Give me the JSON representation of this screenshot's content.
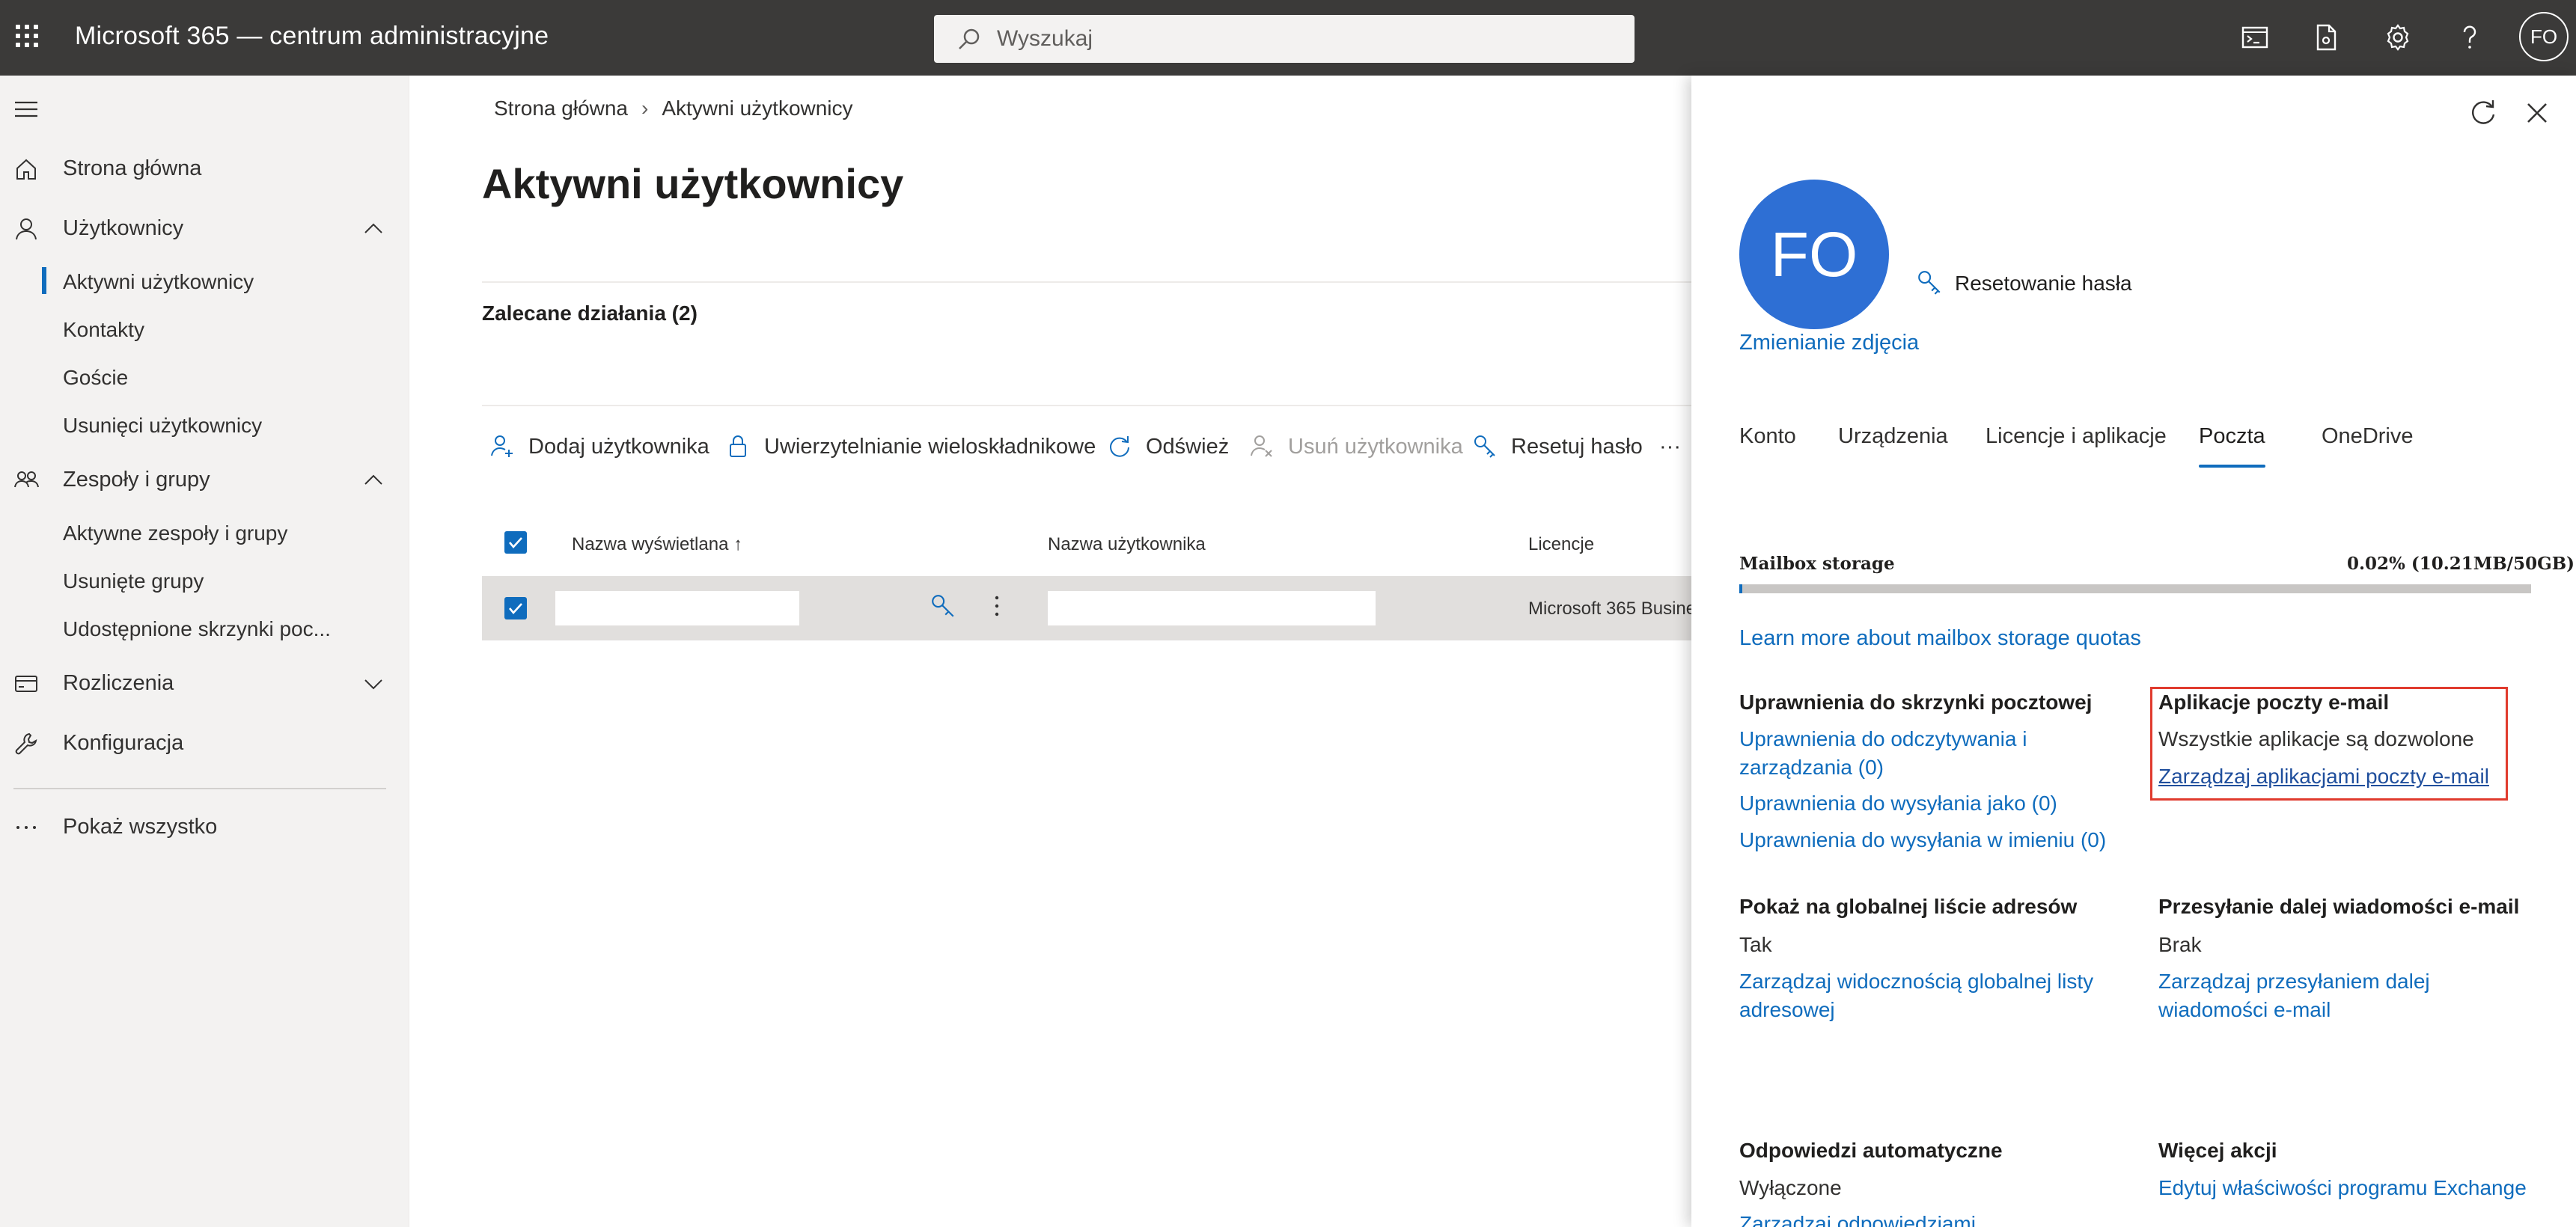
{
  "header": {
    "app_title": "Microsoft 365 — centrum administracyjne",
    "search_placeholder": "Wyszukaj",
    "user_initials": "FO"
  },
  "nav": {
    "home": "Strona główna",
    "users": "Użytkownicy",
    "users_sub": [
      "Aktywni użytkownicy",
      "Kontakty",
      "Goście",
      "Usunięci użytkownicy"
    ],
    "teams": "Zespoły i grupy",
    "teams_sub": [
      "Aktywne zespoły i grupy",
      "Usunięte grupy",
      "Udostępnione skrzynki poc..."
    ],
    "billing": "Rozliczenia",
    "setup": "Konfiguracja",
    "show_all": "Pokaż wszystko"
  },
  "main": {
    "breadcrumb": [
      "Strona główna",
      "Aktywni użytkownicy"
    ],
    "title": "Aktywni użytkownicy",
    "recommended": "Zalecane działania (2)",
    "commands": {
      "add_user": "Dodaj użytkownika",
      "mfa": "Uwierzytelnianie wieloskładnikowe",
      "refresh": "Odśwież",
      "delete_user": "Usuń użytkownika",
      "reset_password": "Resetuj hasło",
      "more": "···"
    },
    "table": {
      "headers": [
        "Nazwa wyświetlana",
        "Nazwa użytkownika",
        "Licencje"
      ],
      "sort_indicator": "↑",
      "row": {
        "display_name": "",
        "user_name": "",
        "licenses": "Microsoft 365 Busine"
      }
    }
  },
  "panel": {
    "initials": "FO",
    "reset_password": "Resetowanie hasła",
    "change_photo": "Zmienianie zdjęcia",
    "tabs": [
      "Konto",
      "Urządzenia",
      "Licencje i aplikacje",
      "Poczta",
      "OneDrive"
    ],
    "active_tab": "Poczta",
    "mailbox": {
      "label": "Mailbox storage",
      "value": "0.02% (10.21MB/50GB)",
      "used_fraction": 0.0002,
      "learn_more": "Learn more about mailbox storage quotas"
    },
    "permissions": {
      "title": "Uprawnienia do skrzynki pocztowej",
      "read_manage": "Uprawnienia do odczytywania i zarządzania (0)",
      "send_as": "Uprawnienia do wysyłania jako (0)",
      "send_on_behalf": "Uprawnienia do wysyłania w imieniu (0)"
    },
    "email_apps": {
      "title": "Aplikacje poczty e-mail",
      "status": "Wszystkie aplikacje są dozwolone",
      "manage": "Zarządzaj aplikacjami poczty e-mail"
    },
    "gal": {
      "title": "Pokaż na globalnej liście adresów",
      "value": "Tak",
      "manage": "Zarządzaj widocznością globalnej listy adresowej"
    },
    "forwarding": {
      "title": "Przesyłanie dalej wiadomości e-mail",
      "value": "Brak",
      "manage": "Zarządzaj przesyłaniem dalej wiadomości e-mail"
    },
    "auto_replies": {
      "title": "Odpowiedzi automatyczne",
      "value": "Wyłączone",
      "manage": "Zarządzaj odpowiedziami automatycznymi"
    },
    "more_actions": {
      "title": "Więcej akcji",
      "exchange": "Edytuj właściwości programu Exchange"
    }
  },
  "colors": {
    "accent": "#0f6cbd",
    "topbar": "#3b3a39",
    "avatar": "#2e6fd4",
    "highlight": "#e03b2e"
  }
}
